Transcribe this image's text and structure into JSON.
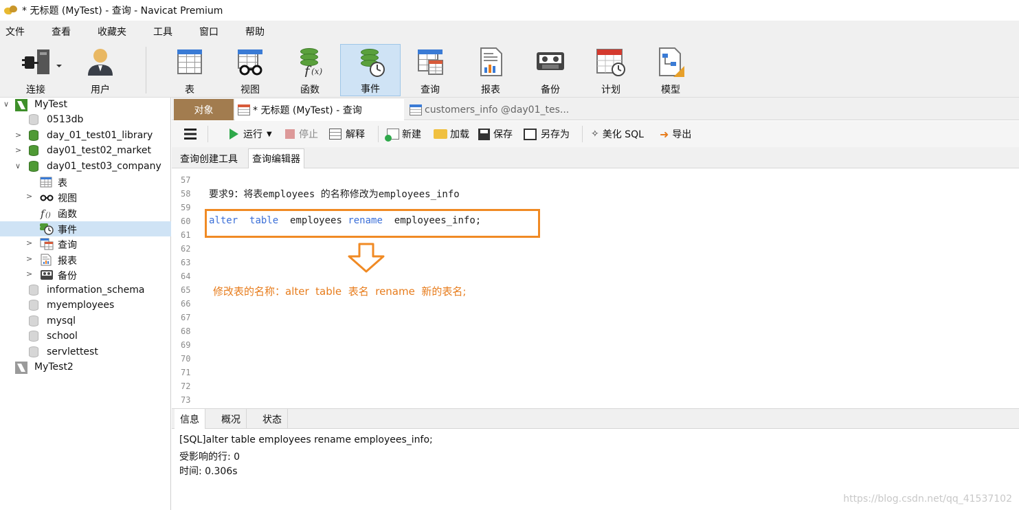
{
  "window": {
    "title": "* 无标题 (MyTest) - 查询 - Navicat Premium"
  },
  "menu": [
    "文件",
    "查看",
    "收藏夹",
    "工具",
    "窗口",
    "帮助"
  ],
  "toolbar": {
    "connect": "连接",
    "user": "用户",
    "table": "表",
    "view": "视图",
    "function": "函数",
    "event": "事件",
    "query": "查询",
    "report": "报表",
    "backup": "备份",
    "schedule": "计划",
    "model": "模型",
    "active": "事件"
  },
  "sidebar": {
    "connection": "MyTest",
    "db_0513": "0513db",
    "db_library": "day_01_test01_library",
    "db_market": "day01_test02_market",
    "db_company": "day01_test03_company",
    "tables": "表",
    "views": "视图",
    "functions": "函数",
    "events": "事件",
    "queries": "查询",
    "reports": "报表",
    "backups": "备份",
    "db_info_schema": "information_schema",
    "db_myemployees": "myemployees",
    "db_mysql": "mysql",
    "db_school": "school",
    "db_servlettest": "servlettest",
    "connection2": "MyTest2",
    "selected": "事件"
  },
  "doc_tabs": {
    "objects": "对象",
    "query_tab": "* 无标题 (MyTest) - 查询",
    "customers_tab": "customers_info @day01_tes..."
  },
  "editor_toolbar": {
    "run": "运行",
    "stop": "停止",
    "explain": "解释",
    "new": "新建",
    "load": "加载",
    "save": "保存",
    "save_as": "另存为",
    "beautify": "美化 SQL",
    "export": "导出"
  },
  "sub_tabs": {
    "builder": "查询创建工具",
    "editor": "查询编辑器"
  },
  "editor": {
    "lines": [
      "57",
      "58",
      "59",
      "60",
      "61",
      "62",
      "63",
      "64",
      "65",
      "66",
      "67",
      "68",
      "69",
      "70",
      "71",
      "72",
      "73"
    ],
    "line58": "要求9：将表employees 的名称修改为employees_info",
    "line60_kw1": "alter",
    "line60_kw2": "table",
    "line60_name": "employees",
    "line60_kw3": "rename",
    "line60_new": "employees_info;",
    "annotation": "修改表的名称：alter  table  表名  rename  新的表名;"
  },
  "bottom": {
    "tab_info": "信息",
    "tab_summary": "概况",
    "tab_status": "状态",
    "msg_sql": "[SQL]alter  table  employees rename  employees_info;",
    "msg_rows": "受影响的行: 0",
    "msg_time": "时间: 0.306s"
  },
  "watermark": "https://blog.csdn.net/qq_41537102",
  "colors": {
    "accent": "#f08a24",
    "keyword": "#3b6fd8",
    "selected": "#cfe3f5",
    "object_tab": "#a27c4f"
  }
}
